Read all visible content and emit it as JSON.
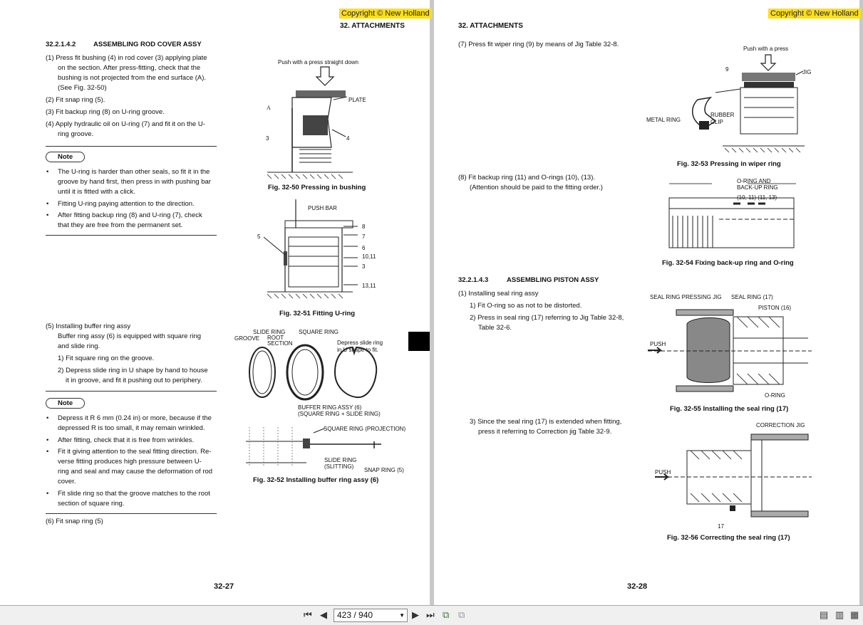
{
  "copyright": "Copyright © New Holland",
  "section": "32. ATTACHMENTS",
  "left": {
    "heading_num": "32.2.1.4.2",
    "heading": "ASSEMBLING ROD COVER ASSY",
    "step1": "(1) Press fit bushing (4) in rod cover (3) applying plate",
    "step1b": "on the section. After press-fitting, check that the",
    "step1c": "bushing is not projected from the end surface (A).",
    "step1d": "(See Fig. 32-50)",
    "step2": "(2) Fit snap ring (5).",
    "step3": "(3) Fit backup ring (8) on U-ring groove.",
    "step4": "(4) Apply hydraulic oil on U-ring (7) and fit it on the U-",
    "step4b": "ring groove.",
    "note_label": "Note",
    "note1a": "The U-ring is harder than other seals, so fit it in the",
    "note1b": "groove by hand first, then press in with pushing bar",
    "note1c": "until it is fitted with a click.",
    "note2": "Fitting U-ring paying attention to the direction.",
    "note3a": "After fitting backup ring (8) and U-ring (7), check",
    "note3b": "that they are free from the permanent set.",
    "step5": "(5) Installing buffer ring assy",
    "step5a": "Buffer ring assy (6) is equipped with square ring",
    "step5b": "and slide ring.",
    "step5c": "1) Fit square ring on the groove.",
    "step5d": "2) Depress slide ring in U shape by hand to house",
    "step5e": "it in groove, and fit it pushing out to periphery.",
    "note2_label": "Note",
    "n2a": "Depress it R 6 mm (0.24 in) or more, because if the",
    "n2b": "depressed R is too small, it may remain wrinkled.",
    "n2c": "After fitting, check that it is free from wrinkles.",
    "n2d": "Fit it giving attention to the seal fitting direction. Re-",
    "n2e": "verse fitting produces high pressure between U-",
    "n2f": "ring and seal and may cause the deformation of rod",
    "n2g": "cover.",
    "n2h": "Fit slide ring so that the groove matches to the root",
    "n2i": "section of square ring.",
    "step6": "(6) Fit snap ring (5)",
    "fig50_push": "Push with a press straight down",
    "fig50_plate": "PLATE",
    "fig50_A": "A",
    "fig50_3": "3",
    "fig50_4": "4",
    "fig50_cap": "Fig. 32-50 Pressing in bushing",
    "fig51_pushbar": "PUSH BAR",
    "fig51_8": "8",
    "fig51_7": "7",
    "fig51_6": "6",
    "fig51_1011": "10,11",
    "fig51_3": "3",
    "fig51_1311": "13,11",
    "fig51_5": "5",
    "fig51_cap": "Fig. 32-51 Fitting U-ring",
    "fig52_slide": "SLIDE RING",
    "fig52_groove": "GROOVE",
    "fig52_root": "ROOT",
    "fig52_section": "SECTION",
    "fig52_square": "SQUARE RING",
    "fig52_depress1": "Depress slide ring",
    "fig52_depress2": "in U shape to fit.",
    "fig52_buffer1": "BUFFER RING ASSY (6)",
    "fig52_buffer2": "(SQUARE RING + SLIDE RING)",
    "fig52_proj": "SQUARE RING (PROJECTION)",
    "fig52_slit1": "SLIDE RING",
    "fig52_slit2": "(SLITTING)",
    "fig52_snap": "SNAP RING (5)",
    "fig52_cap": "Fig. 32-52 Installing buffer ring assy (6)",
    "page": "32-27"
  },
  "right": {
    "step7": "(7) Press fit wiper ring (9) by means of Jig Table 32-8.",
    "fig53_push": "Push with a press",
    "fig53_9": "9",
    "fig53_jig": "JIG",
    "fig53_metal": "METAL RING",
    "fig53_rubber1": "RUBBER",
    "fig53_rubber2": "CLIP",
    "fig53_cap": "Fig. 32-53 Pressing in wiper ring",
    "step8": "(8) Fit backup ring (11) and O-rings (10), (13).",
    "step8b": "(Attention should be paid to the fitting order.)",
    "fig54_l1": "O-RING AND",
    "fig54_l2": "BACK-UP RING",
    "fig54_l3": "(10, 11) (11, 13)",
    "fig54_cap": "Fig. 32-54 Fixing back-up ring and O-ring",
    "heading_num": "32.2.1.4.3",
    "heading": "ASSEMBLING PISTON ASSY",
    "s1": "(1) Installing seal ring assy",
    "s1a": "1) Fit O-ring so as not to be distorted.",
    "s1b": "2) Press in seal ring (17) referring to Jig Table 32-8,",
    "s1c": "Table 32-6.",
    "fig55_sealjig": "SEAL RING PRESSING JIG",
    "fig55_seal": "SEAL RING  (17)",
    "fig55_piston": "PISTON (16)",
    "fig55_push": "PUSH",
    "fig55_oring": "O-RING",
    "fig55_cap": "Fig. 32-55 Installing the seal ring (17)",
    "s3a": "3) Since the seal ring (17) is extended when fitting,",
    "s3b": "press it referring to Correction jig Table 32-9.",
    "fig56_corr": "CORRECTION JIG",
    "fig56_push": "PUSH",
    "fig56_17": "17",
    "fig56_cap": "Fig. 32-56 Correcting the seal ring (17)",
    "page": "32-28"
  },
  "toolbar": {
    "page_value": "423 / 940"
  }
}
